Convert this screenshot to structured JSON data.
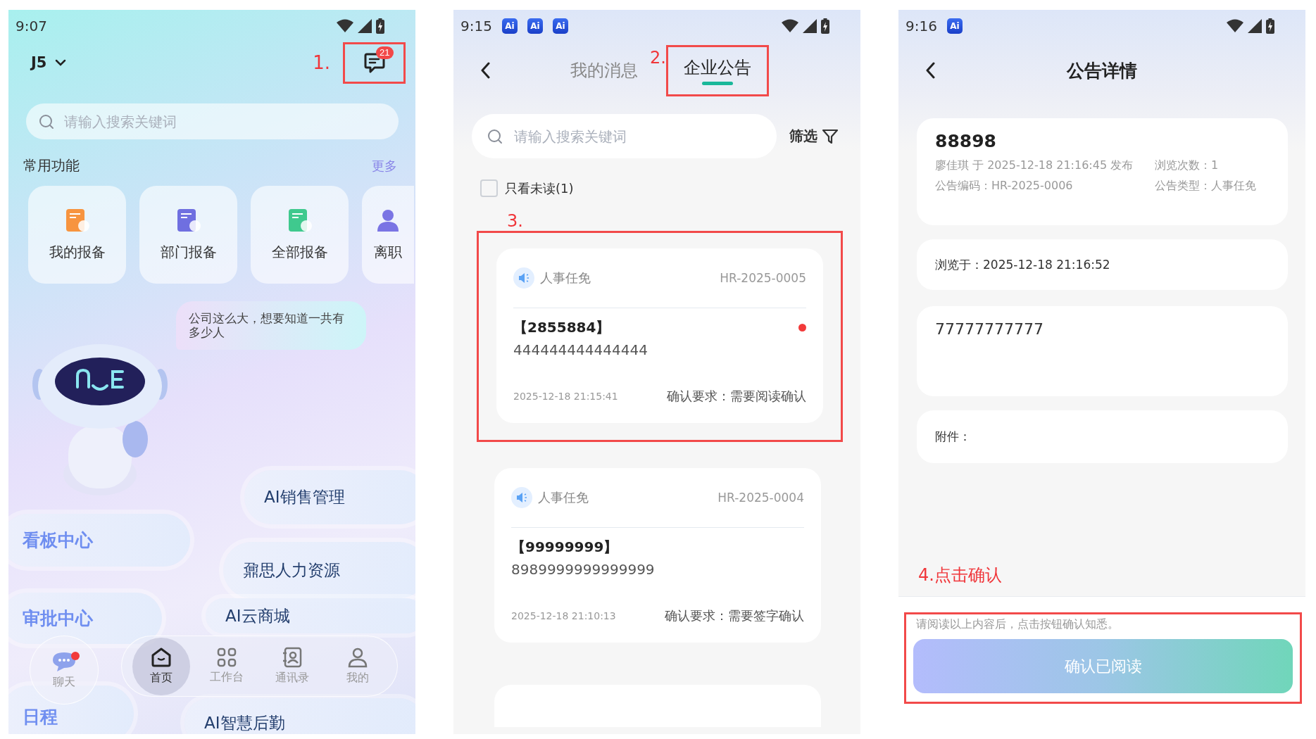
{
  "home_screen": {
    "status_bar": {
      "time": "9:07"
    },
    "org_selector": "J5",
    "annotation": "1.",
    "messages_badge": "21",
    "search": {
      "placeholder": "请输入搜索关键词"
    },
    "section_title": "常用功能",
    "more_link": "更多",
    "functions": [
      {
        "label": "我的报备",
        "kind": "document",
        "color": "#f7943f"
      },
      {
        "label": "部门报备",
        "kind": "document",
        "color": "#6f6fe0"
      },
      {
        "label": "全部报备",
        "kind": "document",
        "color": "#3fc98e"
      },
      {
        "label": "离职",
        "kind": "person",
        "color": "#7a74e4"
      }
    ],
    "assistant_bubble": "公司这么大，想要知道一共有多少人",
    "left_shortcuts": [
      "看板中心",
      "审批中心",
      "日程"
    ],
    "right_shortcuts": [
      "AI销售管理",
      "鼐思人力资源",
      "AI云商城",
      "AI智慧后勤"
    ],
    "chat": {
      "label": "聊天",
      "unread": true
    },
    "nav": [
      {
        "label": "首页",
        "kind": "home",
        "selected": true
      },
      {
        "label": "工作台",
        "kind": "grid",
        "selected": false
      },
      {
        "label": "通讯录",
        "kind": "contacts",
        "selected": false
      },
      {
        "label": "我的",
        "kind": "person",
        "selected": false
      }
    ]
  },
  "messages_screen": {
    "status_bar": {
      "time": "9:15",
      "notifications": [
        "Ai",
        "Ai",
        "Ai"
      ]
    },
    "tabs": [
      {
        "label": "我的消息",
        "selected": false
      },
      {
        "label": "企业公告",
        "selected": true
      }
    ],
    "tab_annotation": "2.",
    "search": {
      "placeholder": "请输入搜索关键词"
    },
    "filter": "筛选",
    "unread_only": {
      "label": "只看未读(1)",
      "checked": false
    },
    "list_annotation": "3.",
    "announcements": [
      {
        "category": "人事任免",
        "code": "HR-2025-0005",
        "title": "【2855884】",
        "body": "444444444444444",
        "time": "2025-12-18 21:15:41",
        "requirement": "确认要求：需要阅读确认",
        "unread": true
      },
      {
        "category": "人事任免",
        "code": "HR-2025-0004",
        "title": "【99999999】",
        "body": "8989999999999999",
        "time": "2025-12-18 21:10:13",
        "requirement": "确认要求：需要签字确认",
        "unread": false
      }
    ]
  },
  "detail_screen": {
    "status_bar": {
      "time": "9:16",
      "notifications": [
        "Ai"
      ]
    },
    "title": "公告详情",
    "announcement": {
      "title": "88898",
      "published": "廖佳琪 于 2025-12-18 21:16:45 发布",
      "views": "浏览次数：1",
      "code": "公告编码：HR-2025-0006",
      "type": "公告类型：人事任免"
    },
    "viewed_at": "浏览于：2025-12-18 21:16:52",
    "content": "77777777777",
    "attachments_label": "附件：",
    "annotation": "4.点击确认",
    "hint": "请阅读以上内容后，点击按钮确认知悉。",
    "confirm_button": "确认已阅读"
  }
}
